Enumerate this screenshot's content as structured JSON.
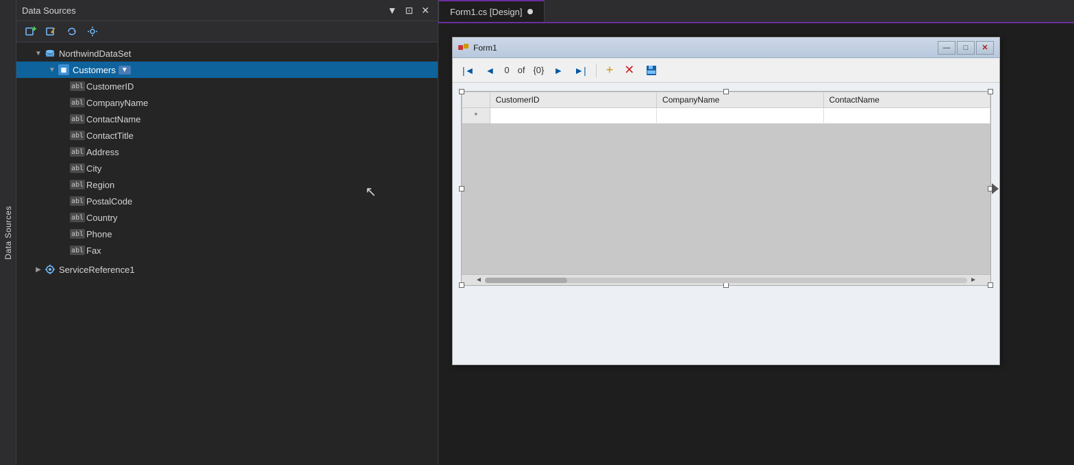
{
  "leftPanel": {
    "verticalTab": "Data Sources",
    "header": {
      "title": "Data Sources",
      "buttons": [
        "▼",
        "⊡",
        "✕"
      ]
    },
    "toolbar": {
      "addDbButton": "Add Database",
      "editButton": "Edit",
      "refreshButton": "Refresh",
      "configButton": "Configure"
    },
    "tree": {
      "dataset": {
        "label": "NorthwindDataSet",
        "expanded": true,
        "tables": [
          {
            "label": "Customers",
            "expanded": true,
            "selected": true,
            "fields": [
              "CustomerID",
              "CompanyName",
              "ContactName",
              "ContactTitle",
              "Address",
              "City",
              "Region",
              "PostalCode",
              "Country",
              "Phone",
              "Fax"
            ]
          }
        ]
      },
      "serviceReference": {
        "label": "ServiceReference1",
        "expanded": false
      }
    }
  },
  "rightPanel": {
    "tab": {
      "label": "Form1.cs [Design]",
      "modified": true
    },
    "form": {
      "title": "Form1",
      "navStrip": {
        "currentRecord": "0",
        "totalRecords": "{0}"
      },
      "datagrid": {
        "columns": [
          "CustomerID",
          "CompanyName",
          "ContactName"
        ],
        "newRowIndicator": "*",
        "scrollLeftLabel": "◄",
        "scrollRightLabel": "►"
      },
      "windowButtons": {
        "minimize": "—",
        "maximize": "□",
        "close": "✕"
      }
    }
  }
}
